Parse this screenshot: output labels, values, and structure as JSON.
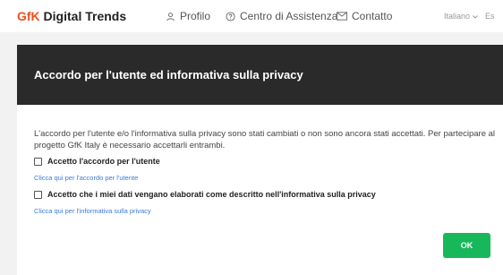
{
  "header": {
    "brand_accent": "GfK",
    "brand_rest": " Digital Trends",
    "nav": {
      "profile": "Profilo",
      "help": "Centro di Assistenza",
      "contact": "Contatto"
    },
    "language": "Italiano",
    "language_next": "Es",
    "icons": {
      "profile": "user-icon",
      "help": "question-circle-icon",
      "contact": "envelope-icon",
      "language": "chevron-down-icon"
    }
  },
  "dialog": {
    "title": "Accordo per l'utente ed informativa sulla privacy",
    "intro": "L'accordo per l'utente e/o l'informativa sulla privacy sono stati cambiati o non sono ancora stati accettati. Per partecipare al progetto GfK Italy è necessario accettarli entrambi.",
    "terms_checkbox_label": "Accetto l'accordo per l'utente",
    "terms_link": "Clicca qui per l'accordo per l'utente",
    "privacy_checkbox_label": "Accetto che i miei dati vengano elaborati come descritto nell'informativa sulla privacy",
    "privacy_link": "Clicca qui per l'informativa sulla privacy",
    "ok_label": "OK"
  },
  "colors": {
    "brand_accent": "#e8521c",
    "header_bg": "#2a2a2a",
    "link": "#3a7bd5",
    "ok_button": "#18b85a"
  }
}
